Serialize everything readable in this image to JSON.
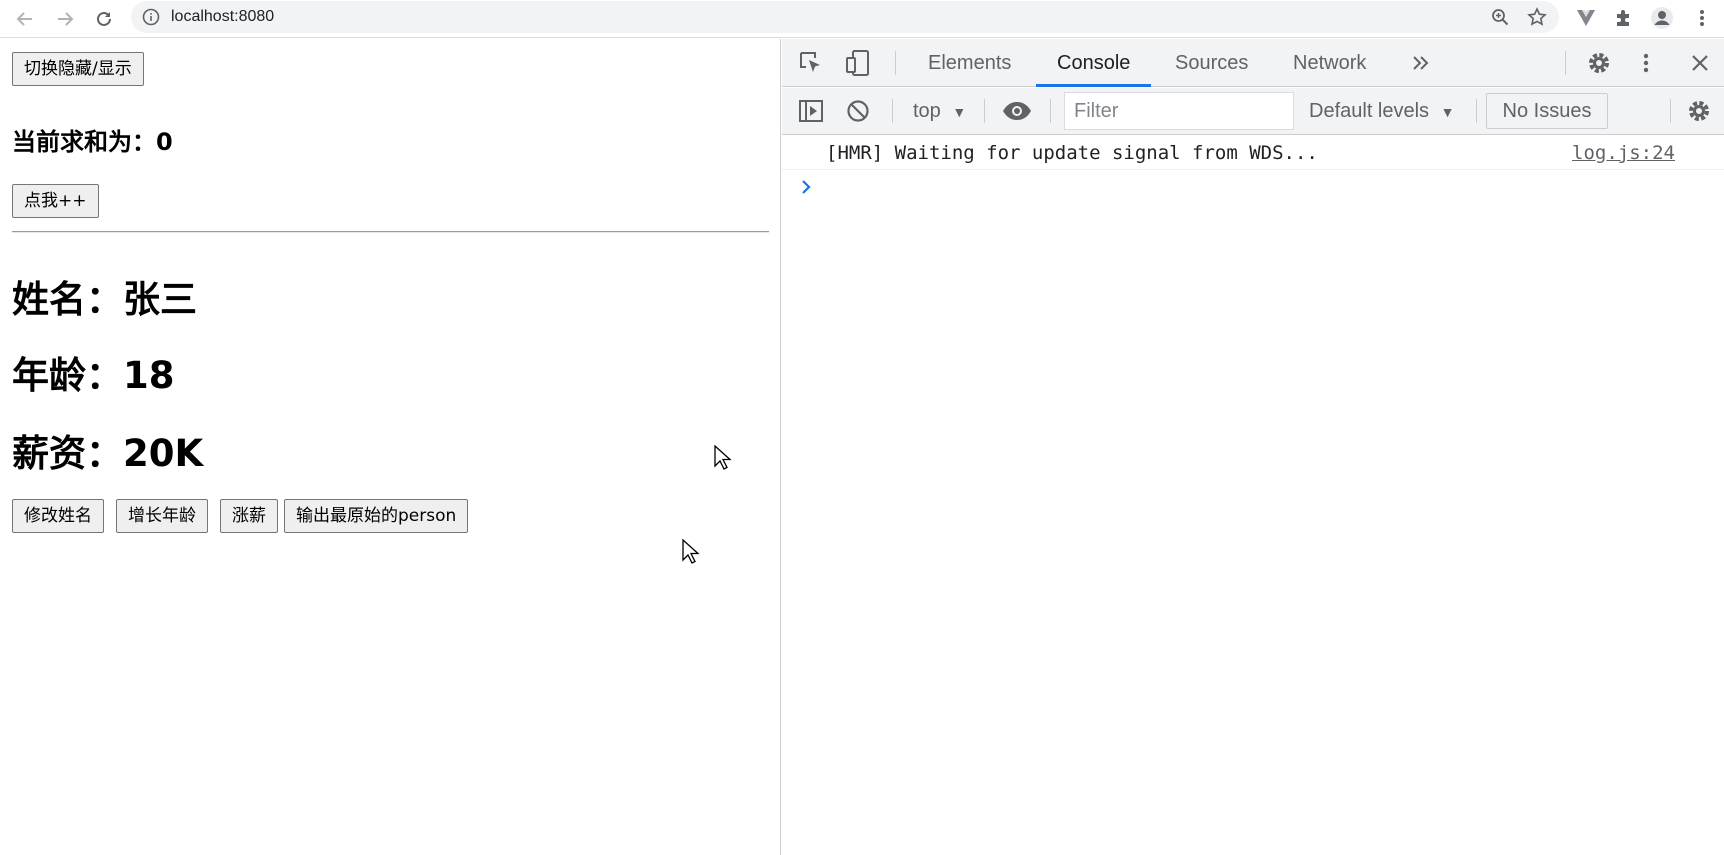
{
  "browser": {
    "url": "localhost:8080",
    "icons": [
      "back-arrow-icon",
      "forward-arrow-icon",
      "reload-icon",
      "info-icon",
      "zoom-icon",
      "star-icon",
      "extension-vue-icon",
      "puzzle-icon",
      "profile-icon",
      "kebab-menu-icon"
    ]
  },
  "page": {
    "toggle_button": "切换隐藏/显示",
    "sum_label": "当前求和为：0",
    "increment_button": "点我++",
    "name_line": "姓名：张三",
    "age_line": "年龄：18",
    "salary_line": "薪资：20K",
    "buttons": {
      "change_name": "修改姓名",
      "grow_age": "增长年龄",
      "raise_salary": "涨薪",
      "print_person": "输出最原始的person"
    }
  },
  "devtools": {
    "tabs": [
      "Elements",
      "Console",
      "Sources",
      "Network"
    ],
    "active_tab": "Console",
    "context": "top",
    "filter_placeholder": "Filter",
    "levels": "Default levels",
    "issues": "No Issues",
    "messages": [
      {
        "text": "[HMR] Waiting for update signal from WDS...",
        "source": "log.js:24"
      }
    ],
    "accent_color": "#1a73e8"
  }
}
